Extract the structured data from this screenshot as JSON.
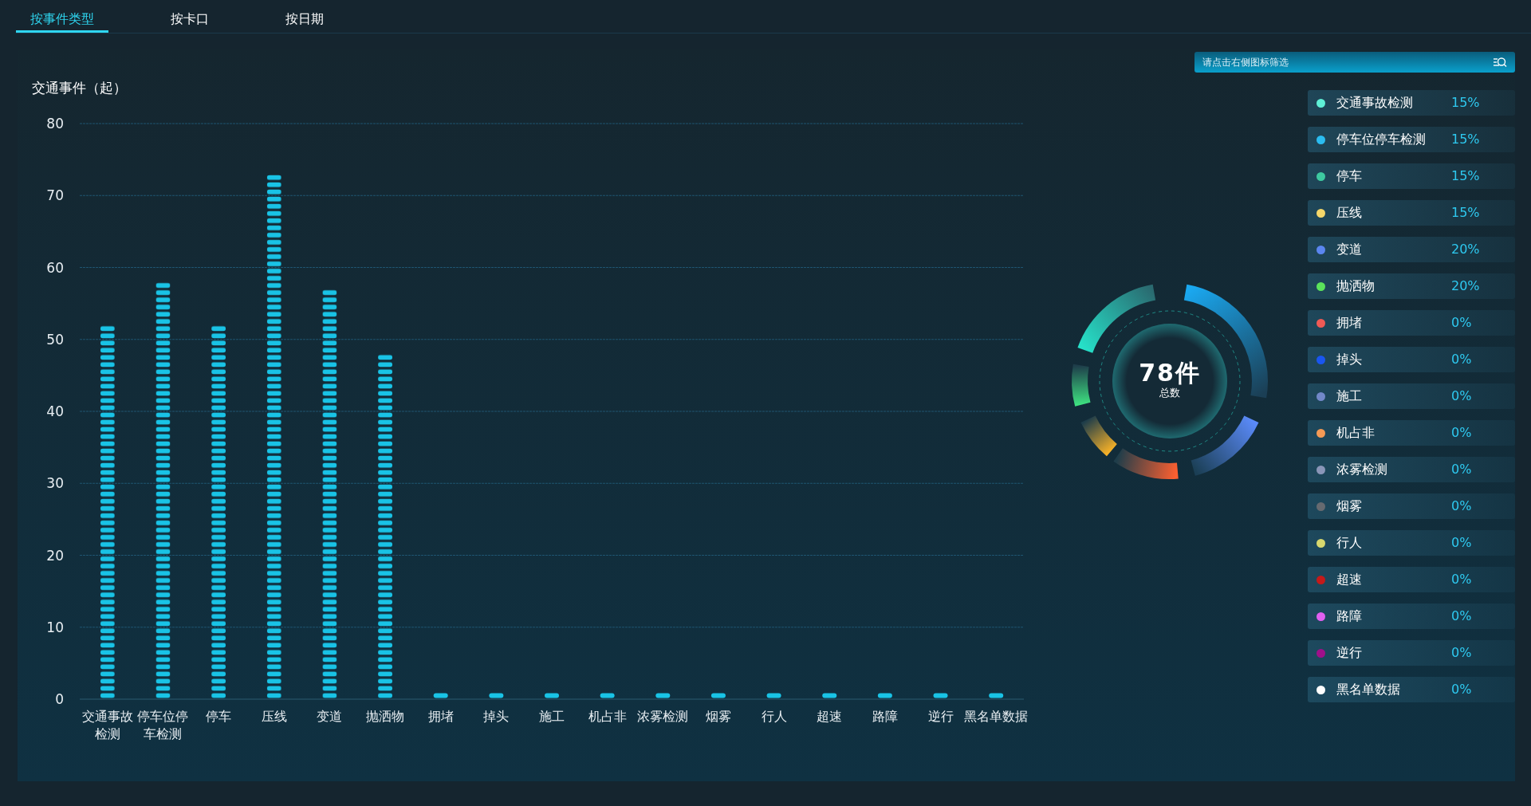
{
  "tabs": [
    {
      "label": "按事件类型",
      "selected": true
    },
    {
      "label": "按卡口",
      "selected": false
    },
    {
      "label": "按日期",
      "selected": false
    }
  ],
  "search": {
    "placeholder": "请点击右侧图标筛选"
  },
  "chart_title": "交通事件（起）",
  "chart_data": {
    "type": "bar",
    "categories": [
      "交通事故检测",
      "停车位停车检测",
      "停车",
      "压线",
      "变道",
      "抛洒物",
      "拥堵",
      "掉头",
      "施工",
      "机占非",
      "浓雾检测",
      "烟雾",
      "行人",
      "超速",
      "路障",
      "逆行",
      "黑名单数据"
    ],
    "grid": true,
    "series": [
      {
        "color": "#19c3e6",
        "values": [
          52,
          58,
          52,
          73,
          57,
          48,
          0,
          0,
          0,
          0,
          0,
          0,
          0,
          0,
          0,
          0,
          0
        ]
      }
    ],
    "ylim": [
      0,
      80
    ],
    "yticks": [
      0,
      10,
      20,
      30,
      40,
      50,
      60,
      70,
      80
    ]
  },
  "donut": {
    "total": "78件",
    "caption": "总数"
  },
  "legend": [
    {
      "name": "交通事故检测",
      "percent": "15%",
      "color": "#5ff0d6"
    },
    {
      "name": "停车位停车检测",
      "percent": "15%",
      "color": "#2bbcf0"
    },
    {
      "name": "停车",
      "percent": "15%",
      "color": "#3ec9a0"
    },
    {
      "name": "压线",
      "percent": "15%",
      "color": "#f5d76a"
    },
    {
      "name": "变道",
      "percent": "20%",
      "color": "#5b86f0"
    },
    {
      "name": "抛洒物",
      "percent": "20%",
      "color": "#5be35b"
    },
    {
      "name": "拥堵",
      "percent": "0%",
      "color": "#f05a55"
    },
    {
      "name": "掉头",
      "percent": "0%",
      "color": "#1a56f0"
    },
    {
      "name": "施工",
      "percent": "0%",
      "color": "#7288c8"
    },
    {
      "name": "机占非",
      "percent": "0%",
      "color": "#f59a55"
    },
    {
      "name": "浓雾检测",
      "percent": "0%",
      "color": "#8a96b8"
    },
    {
      "name": "烟雾",
      "percent": "0%",
      "color": "#666a70"
    },
    {
      "name": "行人",
      "percent": "0%",
      "color": "#d8d86e"
    },
    {
      "name": "超速",
      "percent": "0%",
      "color": "#c41a1a"
    },
    {
      "name": "路障",
      "percent": "0%",
      "color": "#e060f0"
    },
    {
      "name": "逆行",
      "percent": "0%",
      "color": "#a0108a"
    },
    {
      "name": "黑名单数据",
      "percent": "0%",
      "color": "#ffffff"
    }
  ]
}
